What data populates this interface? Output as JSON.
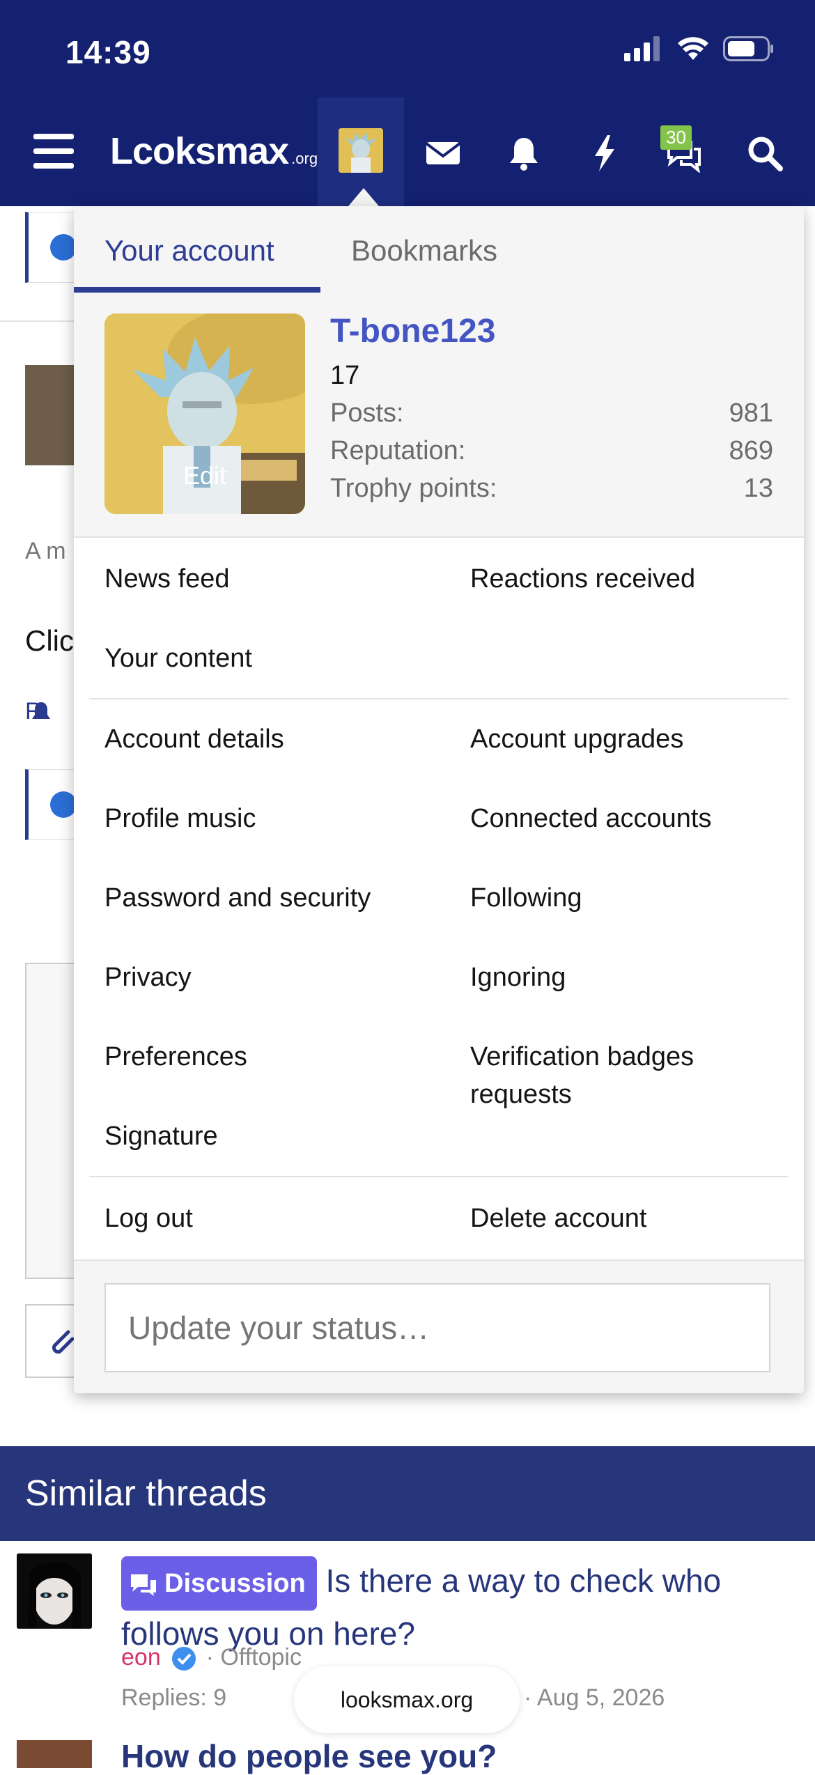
{
  "status_bar": {
    "time": "14:39"
  },
  "header": {
    "logo": "Lcoksmax",
    "logo_suffix": ".org",
    "conversations_badge": "30"
  },
  "menu": {
    "tabs": [
      {
        "label": "Your account",
        "active": true
      },
      {
        "label": "Bookmarks",
        "active": false
      }
    ],
    "profile": {
      "avatar_edit": "Edit",
      "username": "T-bone123",
      "user_title": "17",
      "stats": [
        {
          "label": "Posts:",
          "value": "981"
        },
        {
          "label": "Reputation:",
          "value": "869"
        },
        {
          "label": "Trophy points:",
          "value": "13"
        }
      ]
    },
    "section1": {
      "news_feed": "News feed",
      "reactions_received": "Reactions received",
      "your_content": "Your content"
    },
    "section2": {
      "account_details": "Account details",
      "account_upgrades": "Account upgrades",
      "profile_music": "Profile music",
      "connected_accounts": "Connected accounts",
      "password_security": "Password and security",
      "following": "Following",
      "privacy": "Privacy",
      "ignoring": "Ignoring",
      "preferences": "Preferences",
      "verification_badges": "Verification badges requests",
      "signature": "Signature"
    },
    "section3": {
      "log_out": "Log out",
      "delete_account": "Delete account"
    },
    "status_placeholder": "Update your status…"
  },
  "background": {
    "text_a": "A m",
    "text_click": "Clic",
    "text_r": "R"
  },
  "similar_threads": {
    "title": "Similar threads",
    "thread1": {
      "prefix": "Discussion",
      "title": "Is there a way to check who follows you on here?",
      "author": "eon",
      "forum": "· Offtopic",
      "replies": "Replies: 9",
      "date": "· Aug 5, 2026"
    },
    "thread2": {
      "title": "How do people see you?"
    }
  },
  "browser": {
    "domain": "looksmax.org"
  },
  "colors": {
    "header_bg": "#142170",
    "accent": "#2d3d94",
    "username": "#4355c2",
    "prefix_bg": "#6a5fe6",
    "author": "#d6336c",
    "badge": "#84c34a"
  }
}
